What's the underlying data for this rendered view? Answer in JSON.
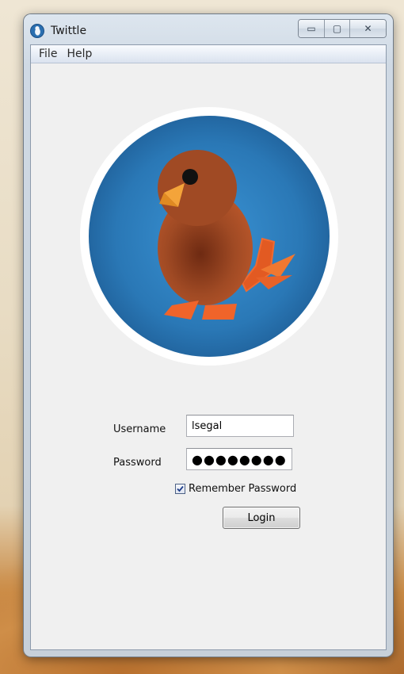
{
  "window": {
    "title": "Twittle",
    "minimize_glyph": "▭",
    "maximize_glyph": "▢",
    "close_glyph": "✕"
  },
  "menu": [
    "File",
    "Help"
  ],
  "login_form": {
    "username_label": "Username",
    "username_value": "lsegal",
    "password_label": "Password",
    "password_value": "●●●●●●●●",
    "remember_label": "Remember Password",
    "remember_checked": true,
    "login_label": "Login"
  },
  "colors": {
    "logo_blue": "#2a78b6",
    "bird_brown": "#8f3f1f",
    "beak_orange": "#f4a43a",
    "feet_orange": "#f0642a"
  },
  "icons": {
    "app": "twittle-app-icon",
    "logo": "twittle-bird-logo",
    "checkbox": "checkmark-icon"
  }
}
